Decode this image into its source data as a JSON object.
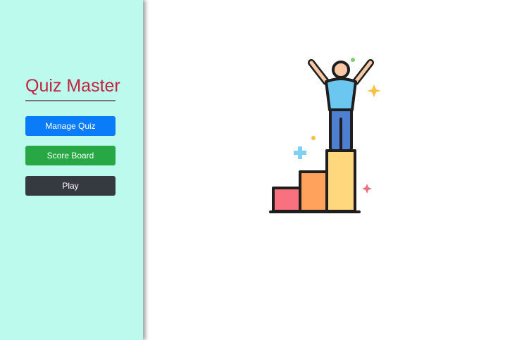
{
  "sidebar": {
    "title": "Quiz Master",
    "buttons": {
      "manage_quiz": "Manage Quiz",
      "score_board": "Score Board",
      "play": "Play"
    }
  },
  "colors": {
    "sidebar_background": "#bdfaee",
    "title": "#c0253f",
    "manage_quiz_button": "#0a7cf8",
    "score_board_button": "#28a745",
    "play_button": "#343a40"
  },
  "main": {
    "illustration": "winner-podium-icon"
  }
}
